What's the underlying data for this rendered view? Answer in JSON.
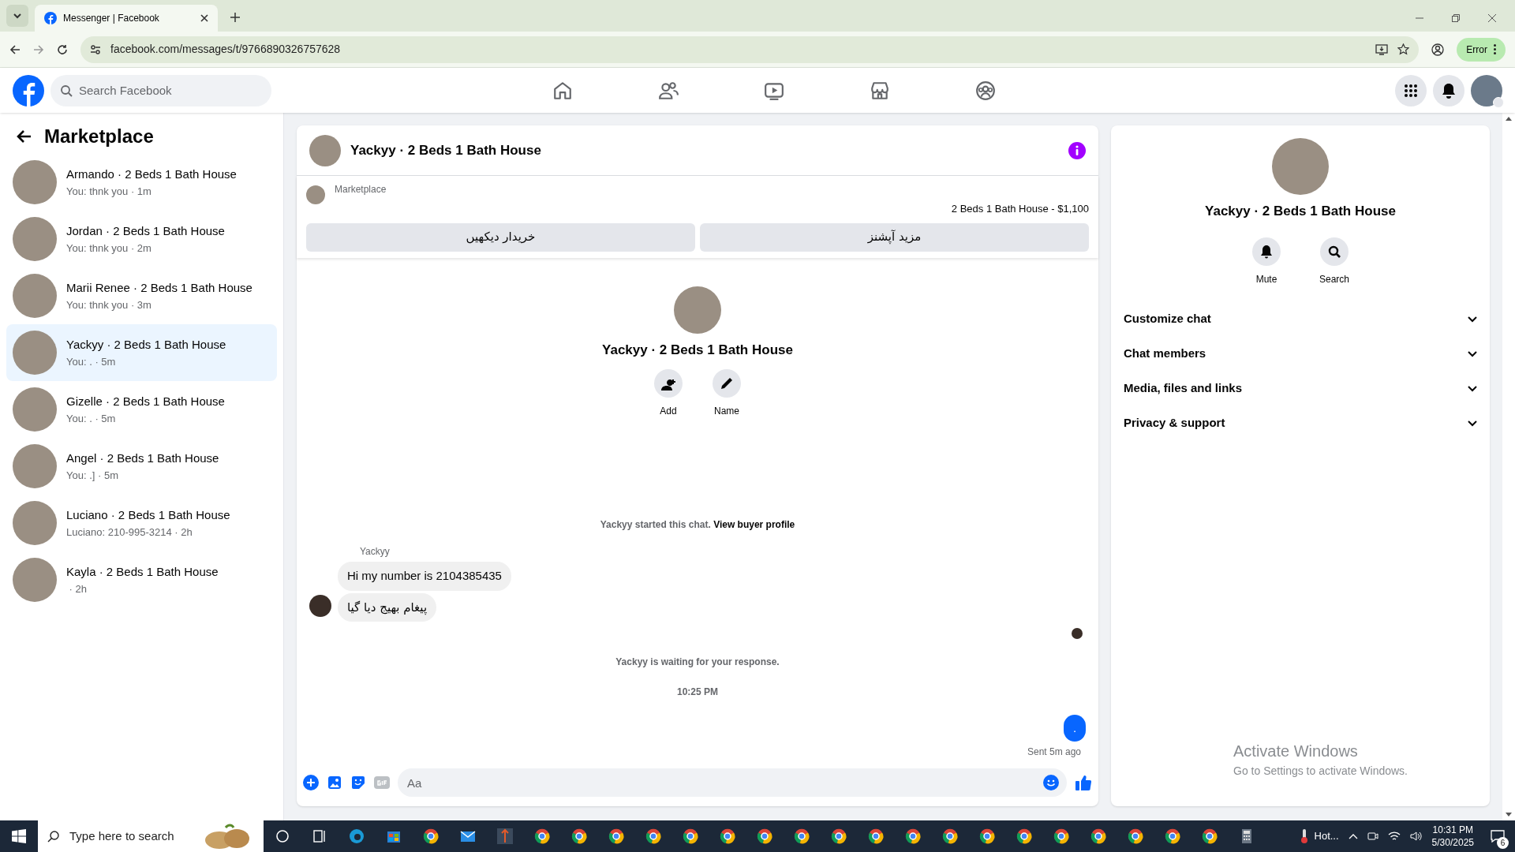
{
  "browser": {
    "tab_title": "Messenger | Facebook",
    "url": "facebook.com/messages/t/9766890326757628",
    "profile_button": "Error"
  },
  "header": {
    "search_placeholder": "Search Facebook"
  },
  "sidebar": {
    "title": "Marketplace",
    "conversations": [
      {
        "title": "Armando · 2 Beds 1 Bath House",
        "preview": "You: thnk you · 1m",
        "selected": false
      },
      {
        "title": "Jordan · 2 Beds 1 Bath House",
        "preview": "You: thnk you · 2m",
        "selected": false
      },
      {
        "title": "Marii Renee · 2 Beds 1 Bath House",
        "preview": "You: thnk you · 3m",
        "selected": false
      },
      {
        "title": "Yackyy · 2 Beds 1 Bath House",
        "preview": "You: . · 5m",
        "selected": true
      },
      {
        "title": "Gizelle · 2 Beds 1 Bath House",
        "preview": "You: . · 5m",
        "selected": false
      },
      {
        "title": "Angel · 2 Beds 1 Bath House",
        "preview": "You: .] · 5m",
        "selected": false
      },
      {
        "title": "Luciano · 2 Beds 1 Bath House",
        "preview": "Luciano: 210-995-3214 · 2h",
        "selected": false
      },
      {
        "title": "Kayla · 2 Beds 1 Bath House",
        "preview": " · 2h",
        "selected": false
      }
    ]
  },
  "chat": {
    "title": "Yackyy · 2 Beds 1 Bath House",
    "listing_label": "Marketplace",
    "listing_item": "2 Beds 1 Bath House - $1,100",
    "buttons": [
      "مزید آپشنز",
      "خریدار دیکھیں"
    ],
    "intro": {
      "title": "Yackyy · 2 Beds 1 Bath House",
      "actions": [
        {
          "kind": "add",
          "label": "Add"
        },
        {
          "kind": "name",
          "label": "Name"
        }
      ]
    },
    "started_text": "Yackyy started this chat.",
    "started_link": "View buyer profile",
    "sender": "Yackyy",
    "incoming": [
      {
        "text": "Hi my number is 2104385435",
        "rtl": false
      },
      {
        "text": "پیغام بھیج دیا گیا",
        "rtl": true
      }
    ],
    "waiting": "Yackyy is waiting for your response.",
    "time": "10:25 PM",
    "outgoing": ".",
    "sent_status": "Sent 5m ago",
    "composer_placeholder": "Aa"
  },
  "details": {
    "title": "Yackyy · 2 Beds 1 Bath House",
    "actions": [
      {
        "kind": "mute",
        "label": "Mute"
      },
      {
        "kind": "search",
        "label": "Search"
      }
    ],
    "sections": [
      {
        "label": "Customize chat",
        "expanded": false
      },
      {
        "label": "Chat members",
        "expanded": false
      },
      {
        "label": "Media, files and links",
        "expanded": false
      },
      {
        "label": "Privacy & support",
        "expanded": false
      }
    ]
  },
  "activation_notice": {
    "title": "Activate Windows",
    "subtitle": "Go to Settings to activate Windows."
  },
  "taskbar": {
    "search_placeholder": "Type here to search",
    "weather": "Hot...",
    "time": "10:31 PM",
    "date": "5/30/2025",
    "notifications": "6"
  }
}
